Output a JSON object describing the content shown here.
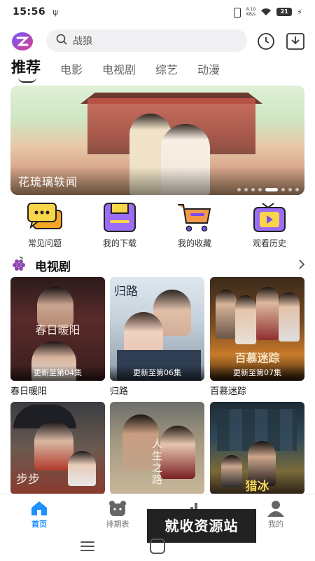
{
  "status_bar": {
    "time": "15:56",
    "usb_icon": "usb-icon",
    "net_speed_value": "8.10",
    "net_speed_unit": "KB/s",
    "battery": "21"
  },
  "header": {
    "search_placeholder": "战狼",
    "history_icon": "clock-icon",
    "download_icon": "download-icon"
  },
  "tabs": [
    {
      "label": "推荐",
      "active": true
    },
    {
      "label": "电影",
      "active": false
    },
    {
      "label": "电视剧",
      "active": false
    },
    {
      "label": "综艺",
      "active": false
    },
    {
      "label": "动漫",
      "active": false
    }
  ],
  "banner": {
    "caption": "花琉璃轶闻",
    "dots_total": 9,
    "active_dot": 5
  },
  "shortcuts": [
    {
      "label": "常见问题",
      "icon": "chat-bubbles-icon"
    },
    {
      "label": "我的下载",
      "icon": "floppy-disk-icon"
    },
    {
      "label": "我的收藏",
      "icon": "shopping-cart-icon"
    },
    {
      "label": "观看历史",
      "icon": "tv-play-icon"
    }
  ],
  "section": {
    "title": "电视剧",
    "icon": "grape-icon",
    "more_icon": "chevron-right-icon"
  },
  "shows": [
    {
      "name": "春日暖阳",
      "update": "更新至第04集",
      "poster_text": "春日暖阳"
    },
    {
      "name": "归路",
      "update": "更新至第06集",
      "poster_text": "归路"
    },
    {
      "name": "百慕迷踪",
      "update": "更新至第07集",
      "poster_text": "百慕迷踪"
    },
    {
      "name": "",
      "update": "",
      "poster_text": "步步"
    },
    {
      "name": "",
      "update": "",
      "poster_text": "人生之路"
    },
    {
      "name": "",
      "update": "",
      "poster_text": "猎冰"
    }
  ],
  "bottom_nav": [
    {
      "label": "首页",
      "icon": "home-icon",
      "active": true
    },
    {
      "label": "排期表",
      "icon": "calendar-bear-icon",
      "active": false
    },
    {
      "label": "",
      "icon": "chart-icon",
      "active": false
    },
    {
      "label": "我的",
      "icon": "user-icon",
      "active": false
    }
  ],
  "watermark": "就收资源站",
  "colors": {
    "accent": "#1e90ff",
    "shortcut_yellow": "#f6c343",
    "shortcut_purple": "#7b4cf2",
    "shortcut_orange": "#f2994a"
  }
}
